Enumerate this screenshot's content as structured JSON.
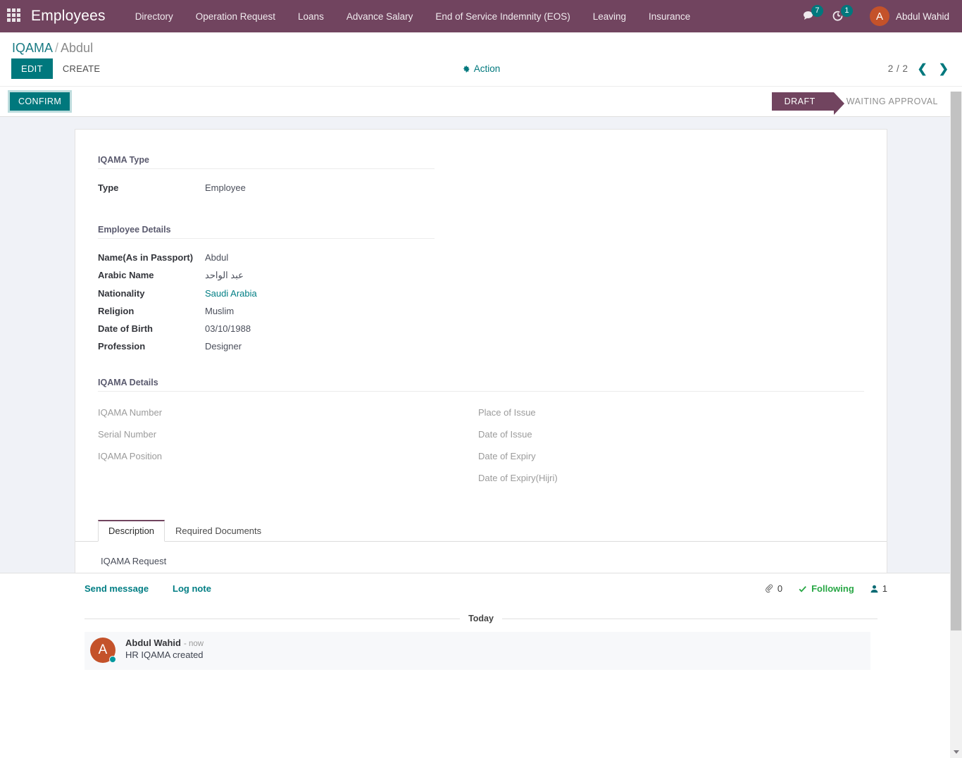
{
  "navbar": {
    "apps_icon": "apps-grid-icon",
    "brand": "Employees",
    "menu": [
      {
        "label": "Directory"
      },
      {
        "label": "Operation Request"
      },
      {
        "label": "Loans"
      },
      {
        "label": "Advance Salary"
      },
      {
        "label": "End of Service Indemnity (EOS)"
      },
      {
        "label": "Leaving"
      },
      {
        "label": "Insurance"
      }
    ],
    "messages_icon": "chat-bubble-icon",
    "messages_count": "7",
    "activities_icon": "clock-activity-icon",
    "activities_count": "1",
    "user_initial": "A",
    "user_name": "Abdul Wahid",
    "bg_color": "#71445f",
    "badge_color": "#00787d"
  },
  "control_panel": {
    "breadcrumb_root": "IQAMA",
    "breadcrumb_sep": "/",
    "breadcrumb_current": "Abdul",
    "edit_label": "EDIT",
    "create_label": "CREATE",
    "action_label": "Action",
    "action_icon": "gear-icon",
    "pager_value": "2 / 2",
    "prev_icon": "chevron-left-icon",
    "next_icon": "chevron-right-icon",
    "accent_color": "#00787d"
  },
  "statusbar": {
    "confirm_label": "CONFIRM",
    "stages": [
      {
        "label": "DRAFT",
        "active": true
      },
      {
        "label": "WAITING APPROVAL",
        "active": false
      }
    ],
    "active_color": "#71445f"
  },
  "form": {
    "group_iqama_type": {
      "title": "IQAMA Type",
      "fields": [
        {
          "label": "Type",
          "value": "Employee"
        }
      ]
    },
    "group_employee_details": {
      "title": "Employee Details",
      "fields": [
        {
          "label": "Name(As in Passport)",
          "value": "Abdul"
        },
        {
          "label": "Arabic Name",
          "value": "عبد الواحد"
        },
        {
          "label": "Nationality",
          "value": "Saudi Arabia"
        },
        {
          "label": "Religion",
          "value": "Muslim"
        },
        {
          "label": "Date of Birth",
          "value": "03/10/1988"
        },
        {
          "label": "Profession",
          "value": "Designer"
        }
      ]
    },
    "group_iqama_details": {
      "title": "IQAMA Details",
      "left_fields": [
        {
          "label": "IQAMA Number",
          "value": ""
        },
        {
          "label": "Serial Number",
          "value": ""
        },
        {
          "label": "IQAMA Position",
          "value": ""
        }
      ],
      "right_fields": [
        {
          "label": "Place of Issue",
          "value": ""
        },
        {
          "label": "Date of Issue",
          "value": ""
        },
        {
          "label": "Date of Expiry",
          "value": ""
        },
        {
          "label": "Date of Expiry(Hijri)",
          "value": ""
        }
      ]
    },
    "notebook": {
      "tabs": [
        {
          "label": "Description",
          "active": true
        },
        {
          "label": "Required Documents",
          "active": false
        }
      ],
      "description_text": "IQAMA Request"
    }
  },
  "chatter": {
    "send_message_label": "Send message",
    "log_note_label": "Log note",
    "attachment_icon": "paperclip-icon",
    "attachment_count": "0",
    "following_icon": "check-icon",
    "following_label": "Following",
    "followers_icon": "user-icon",
    "followers_count": "1",
    "date_separator": "Today",
    "messages": [
      {
        "avatar_initial": "A",
        "author": "Abdul Wahid",
        "time": "- now",
        "body": "HR IQAMA created"
      }
    ]
  }
}
